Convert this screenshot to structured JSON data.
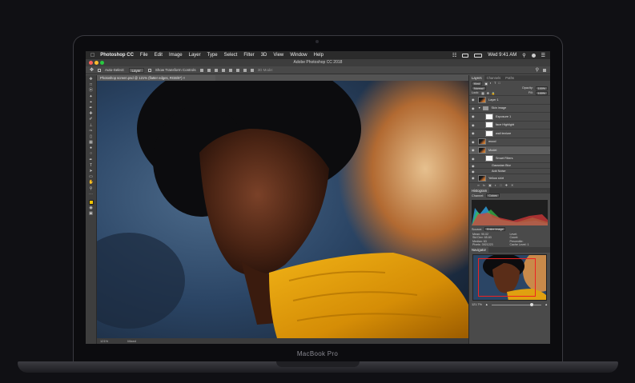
{
  "device": {
    "brand": "MacBook Pro"
  },
  "menubar": {
    "app_name": "Photoshop CC",
    "items": [
      "File",
      "Edit",
      "Image",
      "Layer",
      "Type",
      "Select",
      "Filter",
      "3D",
      "View",
      "Window",
      "Help"
    ],
    "clock": "Wed 9:41 AM"
  },
  "window": {
    "title": "Adobe Photoshop CC 2018"
  },
  "options_bar": {
    "auto_select_label": "Auto-Select:",
    "auto_select_value": "Layer",
    "show_transform_label": "Show Transform Controls",
    "mode_3d_label": "3D Mode:"
  },
  "document": {
    "tab_title": "Photoshop screen.psd @ 121% (flatter edges, RGB/8*) ×",
    "zoom": "121%",
    "status_info": "Mixed"
  },
  "layers_panel": {
    "tabs": [
      "Layers",
      "Channels",
      "Paths"
    ],
    "filter_kind": "Kind",
    "blend_mode": "Normal",
    "opacity_label": "Opacity:",
    "opacity_value": "100%",
    "lock_label": "Lock:",
    "fill_label": "Fill:",
    "fill_value": "100%",
    "layers": [
      {
        "name": "Layer 1",
        "indent": 0,
        "thumb": "photo"
      },
      {
        "name": "Skin image",
        "indent": 0,
        "thumb": "folder"
      },
      {
        "name": "Exposure 1",
        "indent": 1,
        "thumb": "white"
      },
      {
        "name": "face Highlight",
        "indent": 1,
        "thumb": "white"
      },
      {
        "name": "wall texture",
        "indent": 1,
        "thumb": "white"
      },
      {
        "name": "mood",
        "indent": 0,
        "thumb": "photo"
      },
      {
        "name": "Model",
        "indent": 0,
        "thumb": "photo"
      },
      {
        "name": "Smart Filters",
        "indent": 1,
        "thumb": "white"
      },
      {
        "name": "Gaussian Blur",
        "indent": 2,
        "thumb": "none"
      },
      {
        "name": "Add Noise",
        "indent": 2,
        "thumb": "none"
      },
      {
        "name": "Yellow shirt",
        "indent": 0,
        "thumb": "photo"
      }
    ]
  },
  "histogram_panel": {
    "title": "Histogram",
    "channel_label": "Channel:",
    "channel_value": "Colors",
    "source_label": "Source:",
    "source_value": "Entire Image",
    "stats": [
      [
        "Mean: 90.02",
        "Level:"
      ],
      [
        "Std Dev: 65.83",
        "Count:"
      ],
      [
        "Median: 63",
        "Percentile:"
      ],
      [
        "Pixels: 3921223",
        "Cache Level: 1"
      ]
    ]
  },
  "navigator_panel": {
    "title": "Navigator",
    "zoom": "121.7%"
  }
}
